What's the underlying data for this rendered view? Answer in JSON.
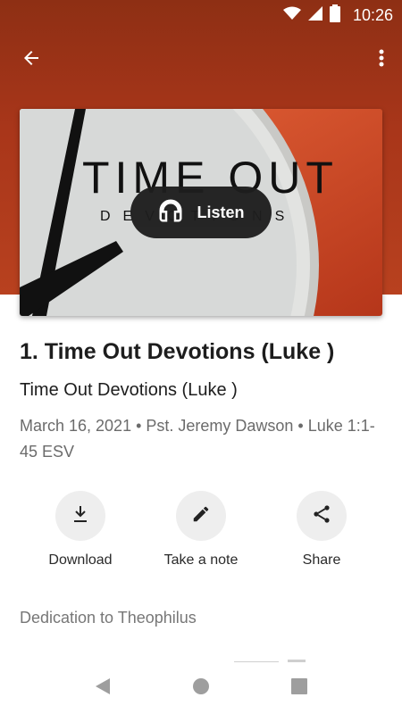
{
  "status_bar": {
    "time": "10:26",
    "icons": [
      "wifi-icon",
      "signal-icon",
      "battery-icon"
    ]
  },
  "app_bar": {
    "back_icon": "arrow-left-icon",
    "more_icon": "more-vert-icon"
  },
  "artwork": {
    "title_text": "TIME OUT",
    "subtitle_text": "DEVOTIONS",
    "listen_label": "Listen",
    "listen_icon": "headphones-icon"
  },
  "episode": {
    "title": "1. Time Out Devotions (Luke )",
    "series": "Time Out Devotions (Luke )",
    "meta": "March 16, 2021 • Pst. Jeremy Dawson • Luke 1:1-45 ESV"
  },
  "actions": [
    {
      "label": "Download",
      "icon": "download-icon"
    },
    {
      "label": "Take a note",
      "icon": "pencil-icon"
    },
    {
      "label": "Share",
      "icon": "share-icon"
    }
  ],
  "description": {
    "heading": "Dedication to Theophilus"
  },
  "colors": {
    "hero": "#a9361a",
    "accent_orange": "#e0562a",
    "action_circle": "#eeeeee"
  },
  "nav_bar": {
    "icons": [
      "back-triangle-icon",
      "home-circle-icon",
      "recents-square-icon"
    ]
  }
}
